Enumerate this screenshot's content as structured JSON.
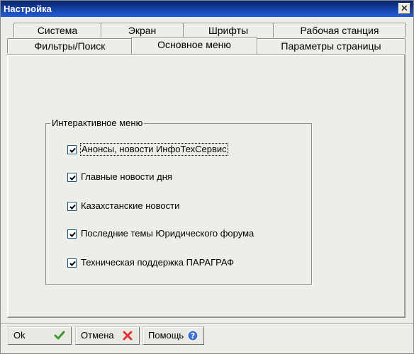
{
  "window": {
    "title": "Настройка",
    "close_glyph": "✕"
  },
  "tabs": {
    "row1": [
      {
        "label": "Система"
      },
      {
        "label": "Экран"
      },
      {
        "label": "Шрифты"
      },
      {
        "label": "Рабочая станция"
      }
    ],
    "row2": [
      {
        "label": "Фильтры/Поиск"
      },
      {
        "label": "Основное меню",
        "active": true
      },
      {
        "label": "Параметры страницы"
      }
    ]
  },
  "group": {
    "legend": "Интерактивное меню",
    "items": [
      {
        "label": "Анонсы, новости ИнфоТехСервис",
        "checked": true,
        "focused": true
      },
      {
        "label": "Главные новости дня",
        "checked": true
      },
      {
        "label": "Казахстанские новости",
        "checked": true
      },
      {
        "label": "Последние темы Юридического форума",
        "checked": true
      },
      {
        "label": "Техническая поддержка ПАРАГРАФ",
        "checked": true
      }
    ]
  },
  "buttons": {
    "ok": {
      "label": "Ok",
      "icon": "checkmark-icon"
    },
    "cancel": {
      "label": "Отмена",
      "icon": "red-x-icon"
    },
    "help": {
      "label": "Помощь",
      "icon": "help-icon"
    }
  },
  "colors": {
    "titlebar_start": "#0a246a",
    "titlebar_end": "#245edb",
    "ok_icon": "#3a9a2a",
    "cancel_icon": "#e03434",
    "help_icon": "#3d6fd1"
  }
}
